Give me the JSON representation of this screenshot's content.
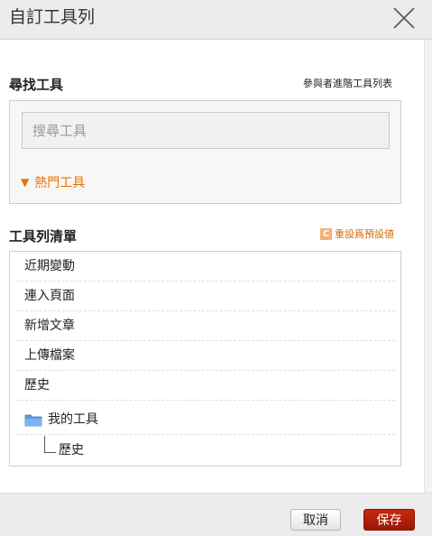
{
  "dialog": {
    "title": "自訂工具列"
  },
  "search_section": {
    "title": "尋找工具",
    "advanced_link": "參與者進階工具列表",
    "search_placeholder": "搜尋工具",
    "search_value": "",
    "popular_label": "熱門工具"
  },
  "toolbar_section": {
    "title": "工具列清單",
    "reset_label": "重設爲預設値",
    "items": [
      {
        "label": "近期變動"
      },
      {
        "label": "連入頁面"
      },
      {
        "label": "新增文章"
      },
      {
        "label": "上傳檔案"
      },
      {
        "label": "歷史"
      }
    ],
    "folder": {
      "label": "我的工具",
      "children": [
        {
          "label": "歷史"
        }
      ]
    }
  },
  "footer": {
    "cancel_label": "取消",
    "save_label": "保存"
  },
  "colors": {
    "accent_orange": "#e3730a",
    "save_red": "#b0200a",
    "folder_blue": "#4a8fd8"
  },
  "icons": {
    "close": "close-icon",
    "folder": "folder-icon",
    "reset": "reset-icon",
    "expand": "triangle-down-icon"
  }
}
